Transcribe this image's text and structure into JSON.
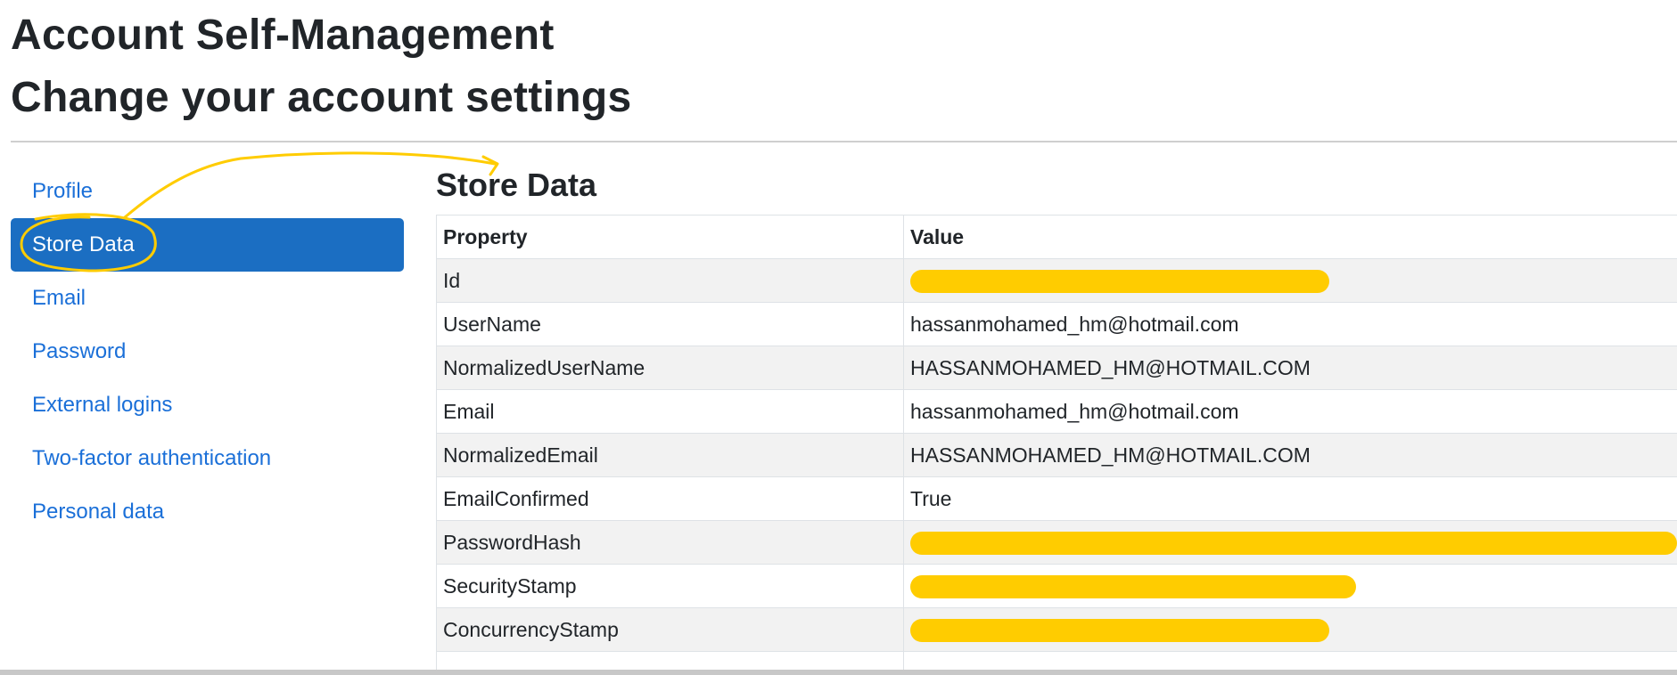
{
  "header": {
    "title": "Account Self-Management",
    "subtitle": "Change your account settings"
  },
  "nav": {
    "items": [
      {
        "label": "Profile",
        "active": false
      },
      {
        "label": "Store Data",
        "active": true
      },
      {
        "label": "Email",
        "active": false
      },
      {
        "label": "Password",
        "active": false
      },
      {
        "label": "External logins",
        "active": false
      },
      {
        "label": "Two-factor authentication",
        "active": false
      },
      {
        "label": "Personal data",
        "active": false
      }
    ]
  },
  "store": {
    "title": "Store Data",
    "columns": [
      "Property",
      "Value"
    ],
    "rows": [
      {
        "property": "Id",
        "value": "",
        "redacted": true
      },
      {
        "property": "UserName",
        "value": "hassanmohamed_hm@hotmail.com",
        "redacted": false
      },
      {
        "property": "NormalizedUserName",
        "value": "HASSANMOHAMED_HM@HOTMAIL.COM",
        "redacted": false
      },
      {
        "property": "Email",
        "value": "hassanmohamed_hm@hotmail.com",
        "redacted": false
      },
      {
        "property": "NormalizedEmail",
        "value": "HASSANMOHAMED_HM@HOTMAIL.COM",
        "redacted": false
      },
      {
        "property": "EmailConfirmed",
        "value": "True",
        "redacted": false
      },
      {
        "property": "PasswordHash",
        "value": "",
        "redacted": true
      },
      {
        "property": "SecurityStamp",
        "value": "",
        "redacted": true
      },
      {
        "property": "ConcurrencyStamp",
        "value": "",
        "redacted": true
      },
      {
        "property": "",
        "value": "",
        "redacted": false
      }
    ]
  },
  "colors": {
    "accent": "#1b6ec2",
    "link": "#1a6fd8",
    "highlight": "#ffcc00"
  }
}
